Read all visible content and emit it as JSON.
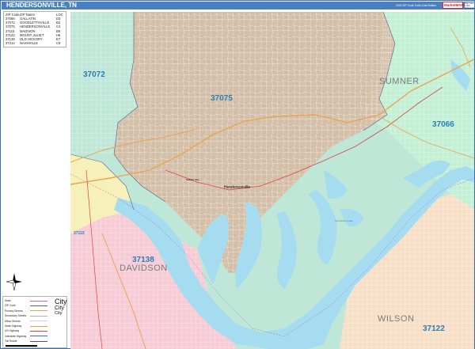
{
  "header": {
    "title": "HENDERSONVILLE, TN",
    "edition": "2023 ZIP Code Color-Cast Edition",
    "logo_text": "MarketMAPS",
    "logo_small": [
      "Map Sales",
      "1-800-",
      "Marketmaps"
    ]
  },
  "zip_table": {
    "headers": [
      "ZIP Code",
      "ZIP Name",
      "LOC"
    ],
    "rows": [
      [
        "37066",
        "GALLATIN",
        "D3"
      ],
      [
        "37072",
        "GOODLETTSVILLE",
        "B3"
      ],
      [
        "37075",
        "HENDERSONVILLE",
        "C4"
      ],
      [
        "37115",
        "MADISON",
        "B6"
      ],
      [
        "37122",
        "MOUNT JULIET",
        "H6"
      ],
      [
        "37138",
        "OLD HICKORY",
        "E7"
      ],
      [
        "37214",
        "NASHVILLE",
        "C8"
      ]
    ]
  },
  "map": {
    "zip_labels": [
      "37072",
      "37075",
      "37066",
      "37138",
      "37122",
      "37115"
    ],
    "county_labels": [
      "SUMNER",
      "DAVIDSON",
      "WILSON"
    ],
    "city_label": "Hendersonville",
    "road_labels": [
      "Gallatin Pike",
      "Old Hickory Lake"
    ],
    "colors": {
      "zip_37075": "#d4bfa8",
      "zip_37072": "#bfe7d8",
      "zip_37066": "#c3f0d5",
      "zip_37138": "#f7cbd6",
      "zip_37122": "#f7dfc7",
      "zip_37115": "#f5f1b8",
      "water": "#a6dcef",
      "border": "#3a6fb0"
    }
  },
  "legend": {
    "rows": [
      "State",
      "ZIP Code",
      "Primary Streets",
      "Secondary Streets",
      "Minor Streets",
      "State Highway",
      "US Highway",
      "Interstate Highway",
      "Toll Roads"
    ],
    "city_sizes": [
      "City",
      "City",
      "City"
    ]
  },
  "compass": {
    "north": "N"
  }
}
